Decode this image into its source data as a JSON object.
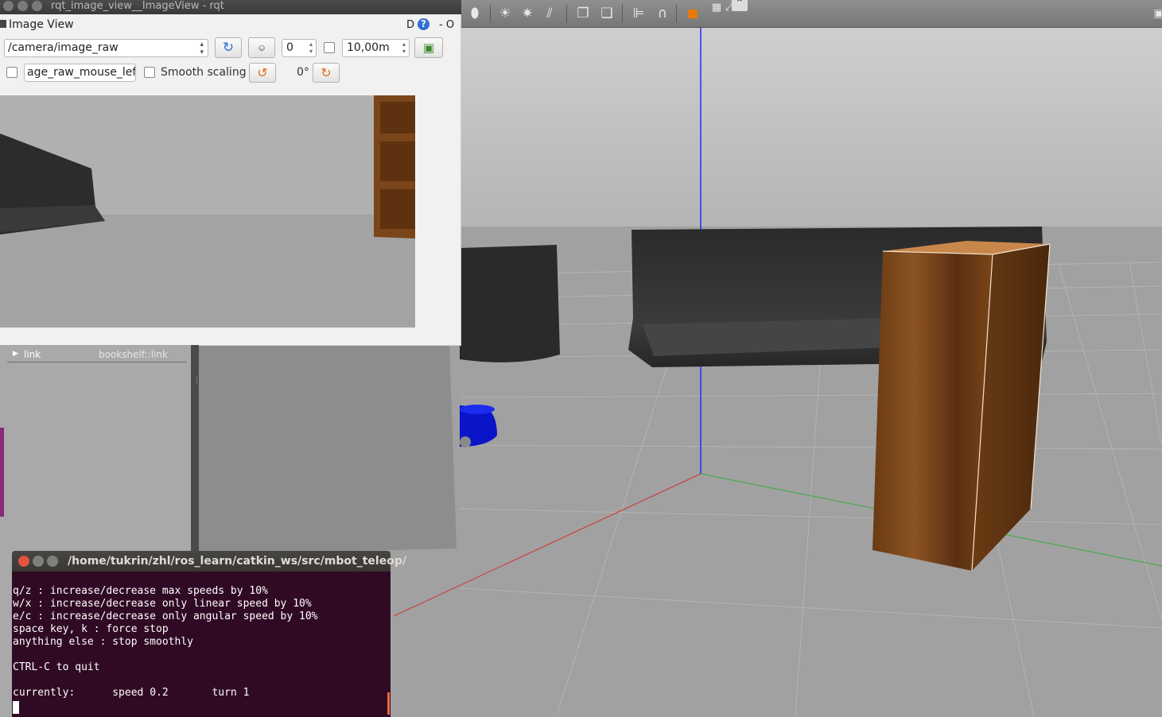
{
  "rqt_window": {
    "title": "rqt_image_view__ImageView - rqt",
    "plugin_title": "Image View",
    "title_controls": "- O",
    "help_d": "D",
    "help_q": "?",
    "topic": "/camera/image_raw",
    "counter_value": "0",
    "depth_value": "10,00m",
    "mouse_topic": "age_raw_mouse_left",
    "smooth_scaling_label": "Smooth scaling",
    "rotation_label": "0°"
  },
  "gazebo": {
    "tree_row_label": "link",
    "tree_row_value": "bookshelf::link"
  },
  "terminal": {
    "title": "/home/tukrin/zhl/ros_learn/catkin_ws/src/mbot_teleop/",
    "lines": [
      "q/z : increase/decrease max speeds by 10%",
      "w/x : increase/decrease only linear speed by 10%",
      "e/c : increase/decrease only angular speed by 10%",
      "space key, k : force stop",
      "anything else : stop smoothly",
      "",
      "CTRL-C to quit",
      "",
      "currently:\tspeed 0.2\tturn 1"
    ]
  },
  "colors": {
    "terminal_bg": "#300a24",
    "gazebo_bg": "#9c9c9c",
    "z_axis": "#1e2dff",
    "x_axis": "#d23030",
    "y_axis": "#3ba83b"
  }
}
